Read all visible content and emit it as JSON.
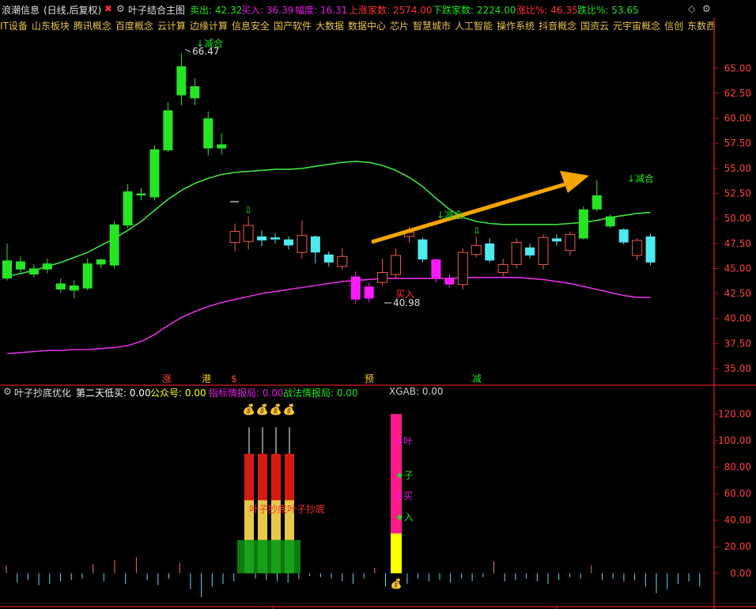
{
  "header": {
    "stock": "浪潮信息",
    "period": "(日线,后复权)",
    "indicator": "叶子结合主图",
    "items": [
      {
        "label": "卖出:",
        "value": "42.32",
        "color": "#19e619"
      },
      {
        "label": "买入:",
        "value": "36.39",
        "color": "#e619e6"
      },
      {
        "label": "幅度:",
        "value": "16.31",
        "color": "#e619e6"
      },
      {
        "label": "上涨家数:",
        "value": "2574.00",
        "color": "#ff3030"
      },
      {
        "label": "下跌家数:",
        "value": "2224.00",
        "color": "#19e619"
      },
      {
        "label": "涨比%:",
        "value": "46.35",
        "color": "#ff3030"
      },
      {
        "label": "跌比%:",
        "value": "53.65",
        "color": "#19e619"
      }
    ]
  },
  "concepts": [
    "IT设备",
    "山东板块",
    "腾讯概念",
    "百度概念",
    "云计算",
    "边缘计算",
    "信息安全",
    "国产软件",
    "大数据",
    "数据中心",
    "芯片",
    "智慧城市",
    "人工智能",
    "操作系统",
    "抖音概念",
    "国资云",
    "元宇宙概念",
    "信创",
    "东数西算"
  ],
  "sub_header": {
    "name": "叶子抄底优化",
    "items": [
      {
        "label": "第二天低买:",
        "value": "0.00",
        "color": "#ffffff"
      },
      {
        "label": "公众号:",
        "value": "0.00",
        "color": "#ffff00"
      },
      {
        "label": "指标情报局:",
        "value": "0.00",
        "color": "#e619e6"
      },
      {
        "label": "战法情报局:",
        "value": "0.00",
        "color": "#19e619"
      },
      {
        "label": "XGAB:",
        "value": "0.00",
        "color": "#cccccc"
      }
    ]
  },
  "chart_data": [
    {
      "type": "candlestick",
      "ylim": [
        33.5,
        68.5
      ],
      "yticks": [
        "65.00",
        "62.50",
        "60.00",
        "57.50",
        "55.00",
        "52.50",
        "50.00",
        "47.50",
        "45.00",
        "42.50",
        "40.00",
        "37.50",
        "35.00"
      ],
      "candles": [
        {
          "o": 45.8,
          "c": 44.0,
          "h": 47.5,
          "l": 43.8
        },
        {
          "o": 45.7,
          "c": 44.9,
          "h": 46.2,
          "l": 44.6
        },
        {
          "o": 45.0,
          "c": 44.4,
          "h": 45.4,
          "l": 44.1
        },
        {
          "o": 45.5,
          "c": 44.9,
          "h": 46.0,
          "l": 44.5
        },
        {
          "o": 43.5,
          "c": 42.9,
          "h": 44.0,
          "l": 42.6
        },
        {
          "o": 42.8,
          "c": 43.3,
          "h": 43.8,
          "l": 42.0
        },
        {
          "o": 43.0,
          "c": 45.5,
          "h": 46.0,
          "l": 42.8
        },
        {
          "o": 45.9,
          "c": 45.4,
          "h": 46.0,
          "l": 45.0
        },
        {
          "o": 45.3,
          "c": 49.4,
          "h": 49.7,
          "l": 45.0
        },
        {
          "o": 49.3,
          "c": 52.7,
          "h": 53.4,
          "l": 49.0
        },
        {
          "o": 52.5,
          "c": 52.3,
          "h": 53.0,
          "l": 51.8
        },
        {
          "o": 52.1,
          "c": 56.9,
          "h": 57.3,
          "l": 51.8
        },
        {
          "o": 56.8,
          "c": 60.8,
          "h": 61.6,
          "l": 56.6
        },
        {
          "o": 62.3,
          "c": 65.2,
          "h": 66.5,
          "l": 61.3
        },
        {
          "o": 63.2,
          "c": 62.0,
          "h": 64.0,
          "l": 61.3
        },
        {
          "o": 60.0,
          "c": 57.0,
          "h": 60.7,
          "l": 56.3
        },
        {
          "o": 57.4,
          "c": 57.0,
          "h": 58.5,
          "l": 56.4
        },
        {
          "o": 47.6,
          "c": 48.7,
          "h": 49.5,
          "l": 46.7
        },
        {
          "o": 47.7,
          "c": 49.3,
          "h": 50.2,
          "l": 46.9
        },
        {
          "o": 48.2,
          "c": 47.8,
          "h": 48.8,
          "l": 47.2
        },
        {
          "o": 48.1,
          "c": 47.9,
          "h": 48.5,
          "l": 47.5
        },
        {
          "o": 47.9,
          "c": 47.3,
          "h": 48.2,
          "l": 46.9
        },
        {
          "o": 46.6,
          "c": 48.3,
          "h": 49.8,
          "l": 46.0
        },
        {
          "o": 48.2,
          "c": 46.6,
          "h": 48.3,
          "l": 45.5
        },
        {
          "o": 46.4,
          "c": 45.6,
          "h": 46.7,
          "l": 45.2
        },
        {
          "o": 45.2,
          "c": 46.2,
          "h": 47.0,
          "l": 44.9
        },
        {
          "o": 44.2,
          "c": 41.9,
          "h": 44.7,
          "l": 41.5
        },
        {
          "o": 43.2,
          "c": 42.0,
          "h": 43.6,
          "l": 41.6
        },
        {
          "o": 43.6,
          "c": 44.6,
          "h": 46.0,
          "l": 43.2
        },
        {
          "o": 44.4,
          "c": 46.3,
          "h": 47.0,
          "l": 44.0
        },
        {
          "o": 48.2,
          "c": 48.6,
          "h": 49.2,
          "l": 47.6
        },
        {
          "o": 47.9,
          "c": 45.9,
          "h": 48.1,
          "l": 45.6
        },
        {
          "o": 45.9,
          "c": 44.0,
          "h": 46.0,
          "l": 43.6
        },
        {
          "o": 43.4,
          "c": 44.0,
          "h": 44.5,
          "l": 43.1
        },
        {
          "o": 43.4,
          "c": 46.6,
          "h": 47.0,
          "l": 42.9
        },
        {
          "o": 46.4,
          "c": 47.3,
          "h": 48.2,
          "l": 46.1
        },
        {
          "o": 47.5,
          "c": 45.8,
          "h": 48.0,
          "l": 45.6
        },
        {
          "o": 44.6,
          "c": 45.4,
          "h": 46.0,
          "l": 44.2
        },
        {
          "o": 45.4,
          "c": 47.6,
          "h": 48.0,
          "l": 45.0
        },
        {
          "o": 47.1,
          "c": 46.3,
          "h": 47.5,
          "l": 46.0
        },
        {
          "o": 45.4,
          "c": 48.1,
          "h": 48.4,
          "l": 44.9
        },
        {
          "o": 48.0,
          "c": 47.7,
          "h": 48.4,
          "l": 47.3
        },
        {
          "o": 46.8,
          "c": 48.4,
          "h": 48.7,
          "l": 46.3
        },
        {
          "o": 48.0,
          "c": 50.9,
          "h": 51.2,
          "l": 47.9
        },
        {
          "o": 50.9,
          "c": 52.3,
          "h": 53.8,
          "l": 50.7
        },
        {
          "o": 50.2,
          "c": 49.2,
          "h": 50.4,
          "l": 49.0
        },
        {
          "o": 48.9,
          "c": 47.6,
          "h": 49.0,
          "l": 47.4
        },
        {
          "o": 46.3,
          "c": 47.8,
          "h": 48.0,
          "l": 45.8
        },
        {
          "o": 48.2,
          "c": 45.6,
          "h": 48.5,
          "l": 45.3
        }
      ],
      "upper_band": [
        44.2,
        44.5,
        44.8,
        45.2,
        45.6,
        46.1,
        46.6,
        47.3,
        48.0,
        48.8,
        49.7,
        50.8,
        51.9,
        52.8,
        53.5,
        54.0,
        54.4,
        54.6,
        54.7,
        54.8,
        54.9,
        54.9,
        55.0,
        55.2,
        55.4,
        55.6,
        55.7,
        55.6,
        55.3,
        54.8,
        54.1,
        53.2,
        52.0,
        50.9,
        50.1,
        49.7,
        49.5,
        49.4,
        49.4,
        49.4,
        49.4,
        49.4,
        49.5,
        49.6,
        49.8,
        50.1,
        50.3,
        50.5,
        50.6
      ],
      "lower_band": [
        36.5,
        36.6,
        36.7,
        36.8,
        36.8,
        36.9,
        36.9,
        37.0,
        37.1,
        37.3,
        37.7,
        38.4,
        39.3,
        40.1,
        40.7,
        41.2,
        41.6,
        41.9,
        42.2,
        42.5,
        42.7,
        42.9,
        43.1,
        43.3,
        43.5,
        43.7,
        43.8,
        43.9,
        44.0,
        44.0,
        44.0,
        44.0,
        44.0,
        44.0,
        44.1,
        44.1,
        44.1,
        44.1,
        44.1,
        44.0,
        43.9,
        43.7,
        43.5,
        43.2,
        42.9,
        42.6,
        42.3,
        42.1,
        42.1
      ],
      "annotations": [
        {
          "text": "66.47",
          "color": "#dddddd"
        },
        {
          "text": "40.98",
          "color": "#dddddd"
        },
        {
          "text": "↓减合",
          "color": "#19e619"
        },
        {
          "text": "↓减合",
          "color": "#19e619"
        },
        {
          "text": "↓减仓",
          "color": "#19e619"
        },
        {
          "text": "买入",
          "color": "#ff3030"
        }
      ],
      "bottom_marks": [
        {
          "text": "涨",
          "color": "#ff4040"
        },
        {
          "text": "港",
          "color": "#ffcc00"
        },
        {
          "text": "$",
          "color": "#ff4040"
        },
        {
          "text": "预",
          "color": "#ffcc00"
        },
        {
          "text": "减",
          "color": "#19e619"
        }
      ]
    },
    {
      "type": "bar",
      "ylim": [
        -18,
        128
      ],
      "yticks": [
        "120.00",
        "100.00",
        "80.00",
        "60.00",
        "40.00",
        "20.00",
        "0.00"
      ],
      "overlay_text": "叶子抄底叶子抄底",
      "side_labels": [
        {
          "text": "叶",
          "color": "#e619e6"
        },
        {
          "text": "子",
          "color": "#19e619"
        },
        {
          "text": "买",
          "color": "#e619e6"
        },
        {
          "text": "入",
          "color": "#19e619"
        }
      ],
      "column_values": [
        120,
        30
      ],
      "stack_bars": [
        {
          "top": 90
        },
        {
          "top": 90
        },
        {
          "top": 90
        },
        {
          "top": 90
        }
      ],
      "bars": [
        6,
        -7,
        -5,
        -9,
        -8,
        -6,
        -5,
        -4,
        7,
        -6,
        10,
        -8,
        12,
        -5,
        -9,
        -4,
        8,
        -12,
        -18,
        -10,
        -8,
        -6,
        3,
        -4,
        -5,
        -6,
        -7,
        -4,
        -2,
        -3,
        -4,
        -6,
        -8,
        -4,
        4,
        -10,
        12,
        -8,
        -4,
        -6,
        -5,
        -7,
        -4,
        -6,
        -3,
        9,
        -6,
        -5,
        -4,
        -6,
        -8,
        -5,
        -3,
        -4,
        6,
        -5,
        -4,
        -6,
        -5,
        -10,
        -15,
        -12,
        -8,
        -6,
        -10
      ]
    }
  ]
}
